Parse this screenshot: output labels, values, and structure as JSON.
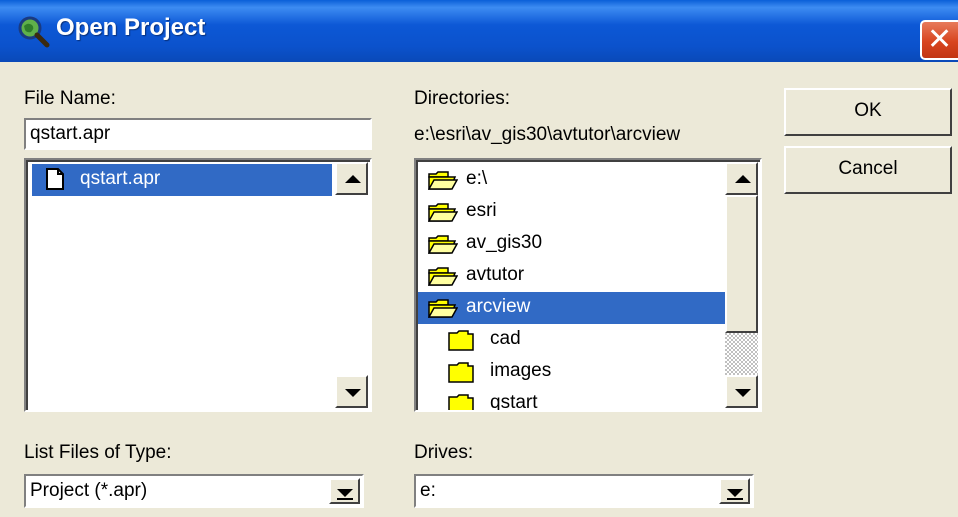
{
  "window": {
    "title": "Open Project",
    "title_icon": "globe-magnifier-icon",
    "close_icon": "close-icon",
    "close_glyph": "✕"
  },
  "file_name": {
    "label": "File Name:",
    "value": "qstart.apr",
    "list": [
      {
        "label": "qstart.apr",
        "icon": "document-icon",
        "selected": true
      }
    ]
  },
  "directories": {
    "label": "Directories:",
    "current_path": "e:\\esri\\av_gis30\\avtutor\\arcview",
    "list": [
      {
        "label": "e:\\",
        "icon": "open-folder-icon",
        "selected": false
      },
      {
        "label": "esri",
        "icon": "open-folder-icon",
        "selected": false
      },
      {
        "label": "av_gis30",
        "icon": "open-folder-icon",
        "selected": false
      },
      {
        "label": "avtutor",
        "icon": "open-folder-icon",
        "selected": false
      },
      {
        "label": "arcview",
        "icon": "open-folder-icon",
        "selected": true
      },
      {
        "label": "cad",
        "icon": "closed-folder-icon",
        "selected": false
      },
      {
        "label": "images",
        "icon": "closed-folder-icon",
        "selected": false
      },
      {
        "label": "qstart",
        "icon": "closed-folder-icon",
        "selected": false
      }
    ]
  },
  "buttons": {
    "ok": "OK",
    "cancel": "Cancel"
  },
  "file_type": {
    "label": "List Files of Type:",
    "value": "Project (*.apr)"
  },
  "drives": {
    "label": "Drives:",
    "value": "e:"
  },
  "colors": {
    "titlebar": "#0b52cc",
    "selection": "#316ac5",
    "dialog_bg": "#ece9d8",
    "close_button": "#d8451f",
    "folder": "#ffff00"
  }
}
